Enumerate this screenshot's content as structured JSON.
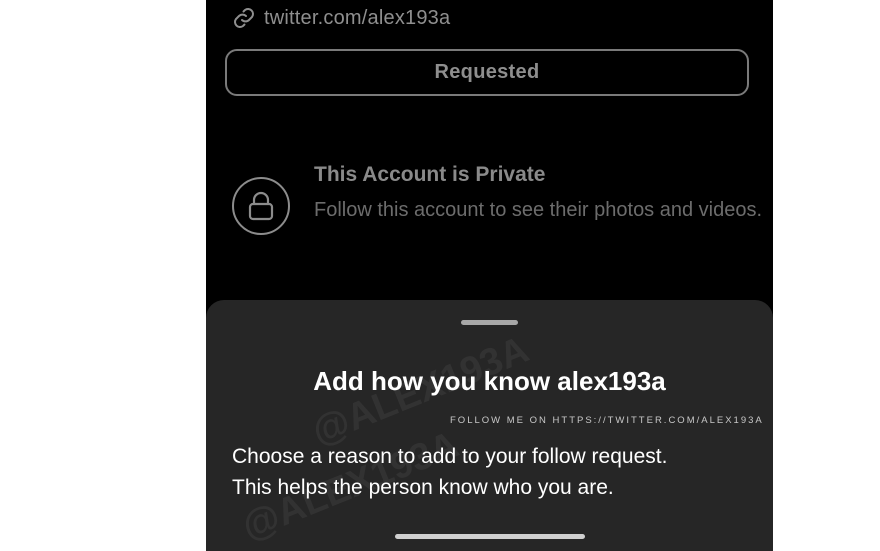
{
  "profile": {
    "link_text": "twitter.com/alex193a",
    "link_icon": "link-icon",
    "requested_label": "Requested"
  },
  "private_notice": {
    "icon": "lock-icon",
    "title": "This Account is Private",
    "description": "Follow this account to see their photos and videos."
  },
  "bottom_sheet": {
    "title": "Add how you know alex193a",
    "body_line1": "Choose a reason to add to your follow request.",
    "body_line2": "This helps the person know who you are."
  },
  "watermark": {
    "ribbon_text": "FOLLOW ME ON HTTPS://TWITTER.COM/ALEX193A",
    "handle_1": "@ALEX193A",
    "handle_2": "@ALEX193A"
  },
  "colors": {
    "background": "#000000",
    "sheet": "#262626",
    "text_primary": "#ffffff",
    "text_muted": "#8a8a8a"
  }
}
